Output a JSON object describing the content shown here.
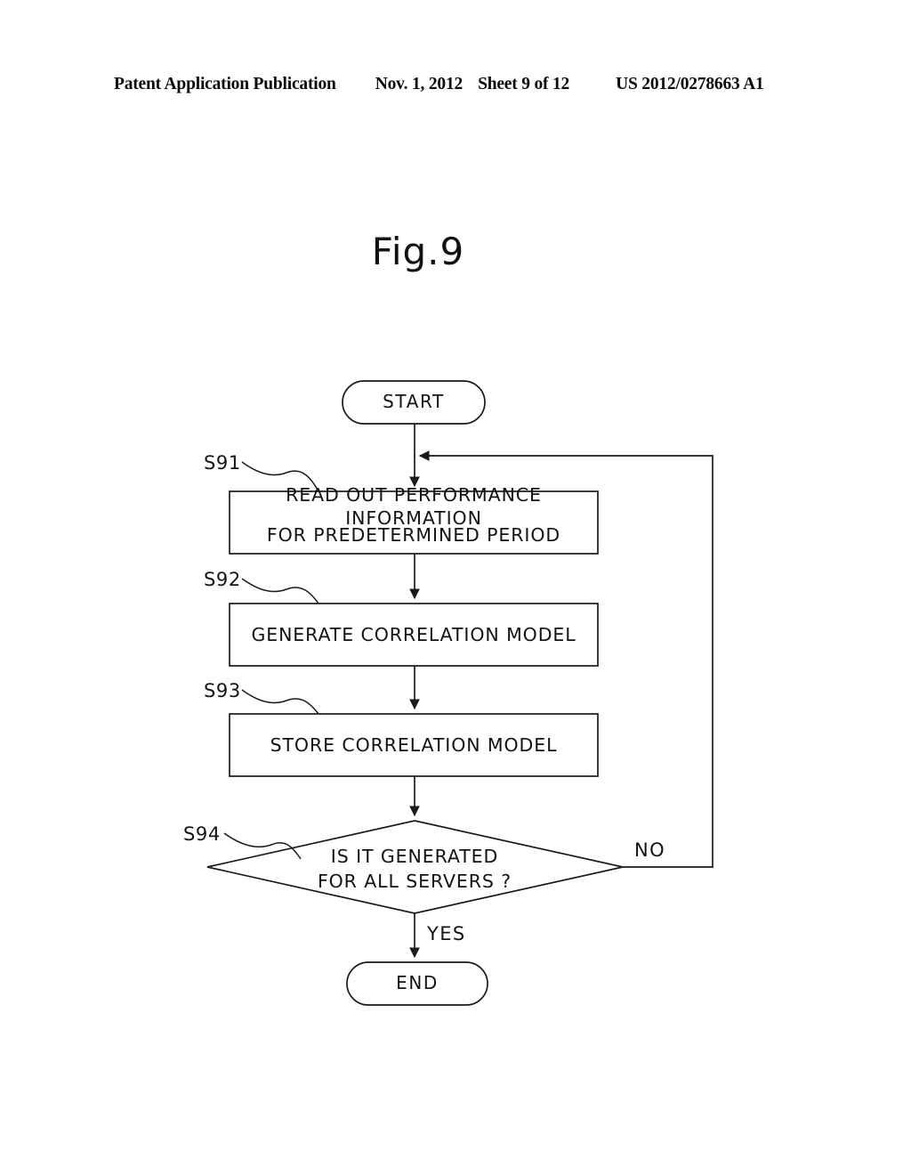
{
  "header": {
    "publication": "Patent Application Publication",
    "date": "Nov. 1, 2012",
    "sheet": "Sheet 9 of 12",
    "doc_number": "US 2012/0278663 A1"
  },
  "figure": {
    "title": "Fig.9"
  },
  "chart_data": {
    "type": "diagram",
    "diagram_kind": "flowchart",
    "title": "Fig.9",
    "orientation": "top-to-bottom",
    "nodes": [
      {
        "id": "start",
        "shape": "terminator",
        "label": "START",
        "step": ""
      },
      {
        "id": "s91",
        "shape": "process",
        "label": "READ OUT PERFORMANCE INFORMATION\nFOR PREDETERMINED PERIOD",
        "step": "S91"
      },
      {
        "id": "s92",
        "shape": "process",
        "label": "GENERATE CORRELATION MODEL",
        "step": "S92"
      },
      {
        "id": "s93",
        "shape": "process",
        "label": "STORE CORRELATION MODEL",
        "step": "S93"
      },
      {
        "id": "s94",
        "shape": "decision",
        "label": "IS IT GENERATED\nFOR ALL SERVERS ?",
        "step": "S94"
      },
      {
        "id": "end",
        "shape": "terminator",
        "label": "END",
        "step": ""
      }
    ],
    "edges": [
      {
        "from": "start",
        "to": "s91",
        "label": ""
      },
      {
        "from": "s91",
        "to": "s92",
        "label": ""
      },
      {
        "from": "s92",
        "to": "s93",
        "label": ""
      },
      {
        "from": "s93",
        "to": "s94",
        "label": ""
      },
      {
        "from": "s94",
        "to": "end",
        "label": "YES"
      },
      {
        "from": "s94",
        "to": "s91",
        "label": "NO"
      }
    ],
    "colors": {
      "stroke": "#1a1a1a",
      "fill": "#ffffff",
      "text": "#121212"
    }
  },
  "nodes": {
    "start": {
      "label": "START"
    },
    "s91": {
      "step": "S91",
      "line1": "READ OUT PERFORMANCE INFORMATION",
      "line2": "FOR PREDETERMINED PERIOD"
    },
    "s92": {
      "step": "S92",
      "label": "GENERATE CORRELATION MODEL"
    },
    "s93": {
      "step": "S93",
      "label": "STORE CORRELATION MODEL"
    },
    "s94": {
      "step": "S94",
      "line1": "IS IT GENERATED",
      "line2": "FOR ALL SERVERS ?"
    },
    "end": {
      "label": "END"
    }
  },
  "branches": {
    "yes": "YES",
    "no": "NO"
  }
}
